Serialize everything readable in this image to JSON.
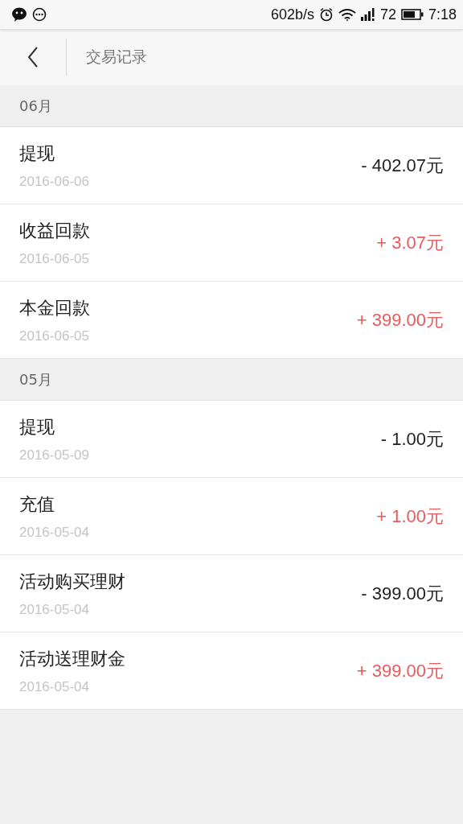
{
  "status_bar": {
    "speed": "602b/s",
    "battery_percent": "72",
    "time": "7:18"
  },
  "header": {
    "title": "交易记录"
  },
  "sections": [
    {
      "month": "06月",
      "records": [
        {
          "name": "提现",
          "date": "2016-06-06",
          "amount": "- 402.07元",
          "kind": "debit"
        },
        {
          "name": "收益回款",
          "date": "2016-06-05",
          "amount": "+ 3.07元",
          "kind": "credit"
        },
        {
          "name": "本金回款",
          "date": "2016-06-05",
          "amount": "+ 399.00元",
          "kind": "credit"
        }
      ]
    },
    {
      "month": "05月",
      "records": [
        {
          "name": "提现",
          "date": "2016-05-09",
          "amount": "- 1.00元",
          "kind": "debit"
        },
        {
          "name": "充值",
          "date": "2016-05-04",
          "amount": "+ 1.00元",
          "kind": "credit"
        },
        {
          "name": "活动购买理财",
          "date": "2016-05-04",
          "amount": "- 399.00元",
          "kind": "debit"
        },
        {
          "name": "活动送理财金",
          "date": "2016-05-04",
          "amount": "+ 399.00元",
          "kind": "credit"
        }
      ]
    }
  ]
}
